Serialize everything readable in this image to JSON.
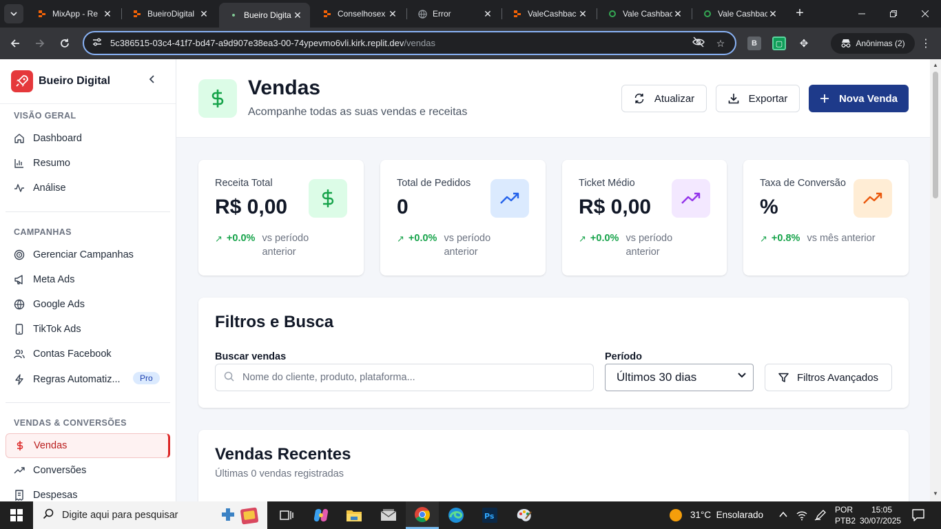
{
  "browser": {
    "tabs": [
      {
        "title": "MixApp - Re",
        "favicon": "replit-icon"
      },
      {
        "title": "BueiroDigital",
        "favicon": "replit-icon"
      },
      {
        "title": "Bueiro Digita",
        "favicon": "dot-icon",
        "active": true
      },
      {
        "title": "Conselhosex",
        "favicon": "replit-icon"
      },
      {
        "title": "Error",
        "favicon": "globe-icon"
      },
      {
        "title": "ValeCashbac",
        "favicon": "replit-icon"
      },
      {
        "title": "Vale Cashbac",
        "favicon": "green-icon"
      },
      {
        "title": "Vale Cashbac",
        "favicon": "green-icon"
      }
    ],
    "url_host": "5c386515-03c4-41f7-bd47-a9d907e38ea3-00-74ypevmo6vli.kirk.replit.dev",
    "url_path": "/vendas",
    "profile_label": "Anônimas (2)"
  },
  "sidebar": {
    "brand": "Bueiro Digital",
    "sections": [
      {
        "title": "VISÃO GERAL",
        "items": [
          {
            "label": "Dashboard",
            "icon": "home-icon"
          },
          {
            "label": "Resumo",
            "icon": "bar-chart-icon"
          },
          {
            "label": "Análise",
            "icon": "activity-icon"
          }
        ]
      },
      {
        "title": "CAMPANHAS",
        "items": [
          {
            "label": "Gerenciar Campanhas",
            "icon": "target-icon"
          },
          {
            "label": "Meta Ads",
            "icon": "megaphone-icon"
          },
          {
            "label": "Google Ads",
            "icon": "globe-icon"
          },
          {
            "label": "TikTok Ads",
            "icon": "smartphone-icon"
          },
          {
            "label": "Contas Facebook",
            "icon": "users-icon"
          },
          {
            "label": "Regras Automatiz...",
            "icon": "zap-icon",
            "badge": "Pro"
          }
        ]
      },
      {
        "title": "VENDAS & CONVERSÕES",
        "items": [
          {
            "label": "Vendas",
            "icon": "dollar-icon",
            "active": true
          },
          {
            "label": "Conversões",
            "icon": "trending-up-icon"
          },
          {
            "label": "Despesas",
            "icon": "receipt-icon"
          }
        ]
      }
    ]
  },
  "header": {
    "title": "Vendas",
    "subtitle": "Acompanhe todas as suas vendas e receitas",
    "refresh_label": "Atualizar",
    "export_label": "Exportar",
    "new_sale_label": "Nova Venda"
  },
  "stats": [
    {
      "label": "Receita Total",
      "value": "R$ 0,00",
      "change": "+0.0%",
      "compare": "vs período anterior",
      "icon": "dollar-icon",
      "icon_bg": "#dcfce7",
      "icon_color": "#16a34a"
    },
    {
      "label": "Total de Pedidos",
      "value": "0",
      "change": "+0.0%",
      "compare": "vs período anterior",
      "icon": "trending-up-icon",
      "icon_bg": "#dbeafe",
      "icon_color": "#2563eb"
    },
    {
      "label": "Ticket Médio",
      "value": "R$ 0,00",
      "change": "+0.0%",
      "compare": "vs período anterior",
      "icon": "trending-up-icon",
      "icon_bg": "#f3e8ff",
      "icon_color": "#9333ea"
    },
    {
      "label": "Taxa de Conversão",
      "value": "%",
      "change": "+0.8%",
      "compare": "vs mês anterior",
      "icon": "trending-up-icon",
      "icon_bg": "#ffedd5",
      "icon_color": "#ea580c"
    }
  ],
  "filters": {
    "title": "Filtros e Busca",
    "search_label": "Buscar vendas",
    "search_placeholder": "Nome do cliente, produto, plataforma...",
    "period_label": "Período",
    "period_value": "Últimos 30 dias",
    "advanced_label": "Filtros Avançados"
  },
  "recent": {
    "title": "Vendas Recentes",
    "subtitle": "Últimas 0 vendas registradas"
  },
  "taskbar": {
    "search_text": "Digite aqui para pesquisar",
    "weather": "31°C  Ensolarado",
    "lang_top": "POR",
    "lang_bottom": "PTB2",
    "time": "15:05",
    "date": "30/07/2025"
  },
  "colors": {
    "accent": "#1e3a8a",
    "brand_red": "#e5383b",
    "positive": "#16a34a"
  }
}
